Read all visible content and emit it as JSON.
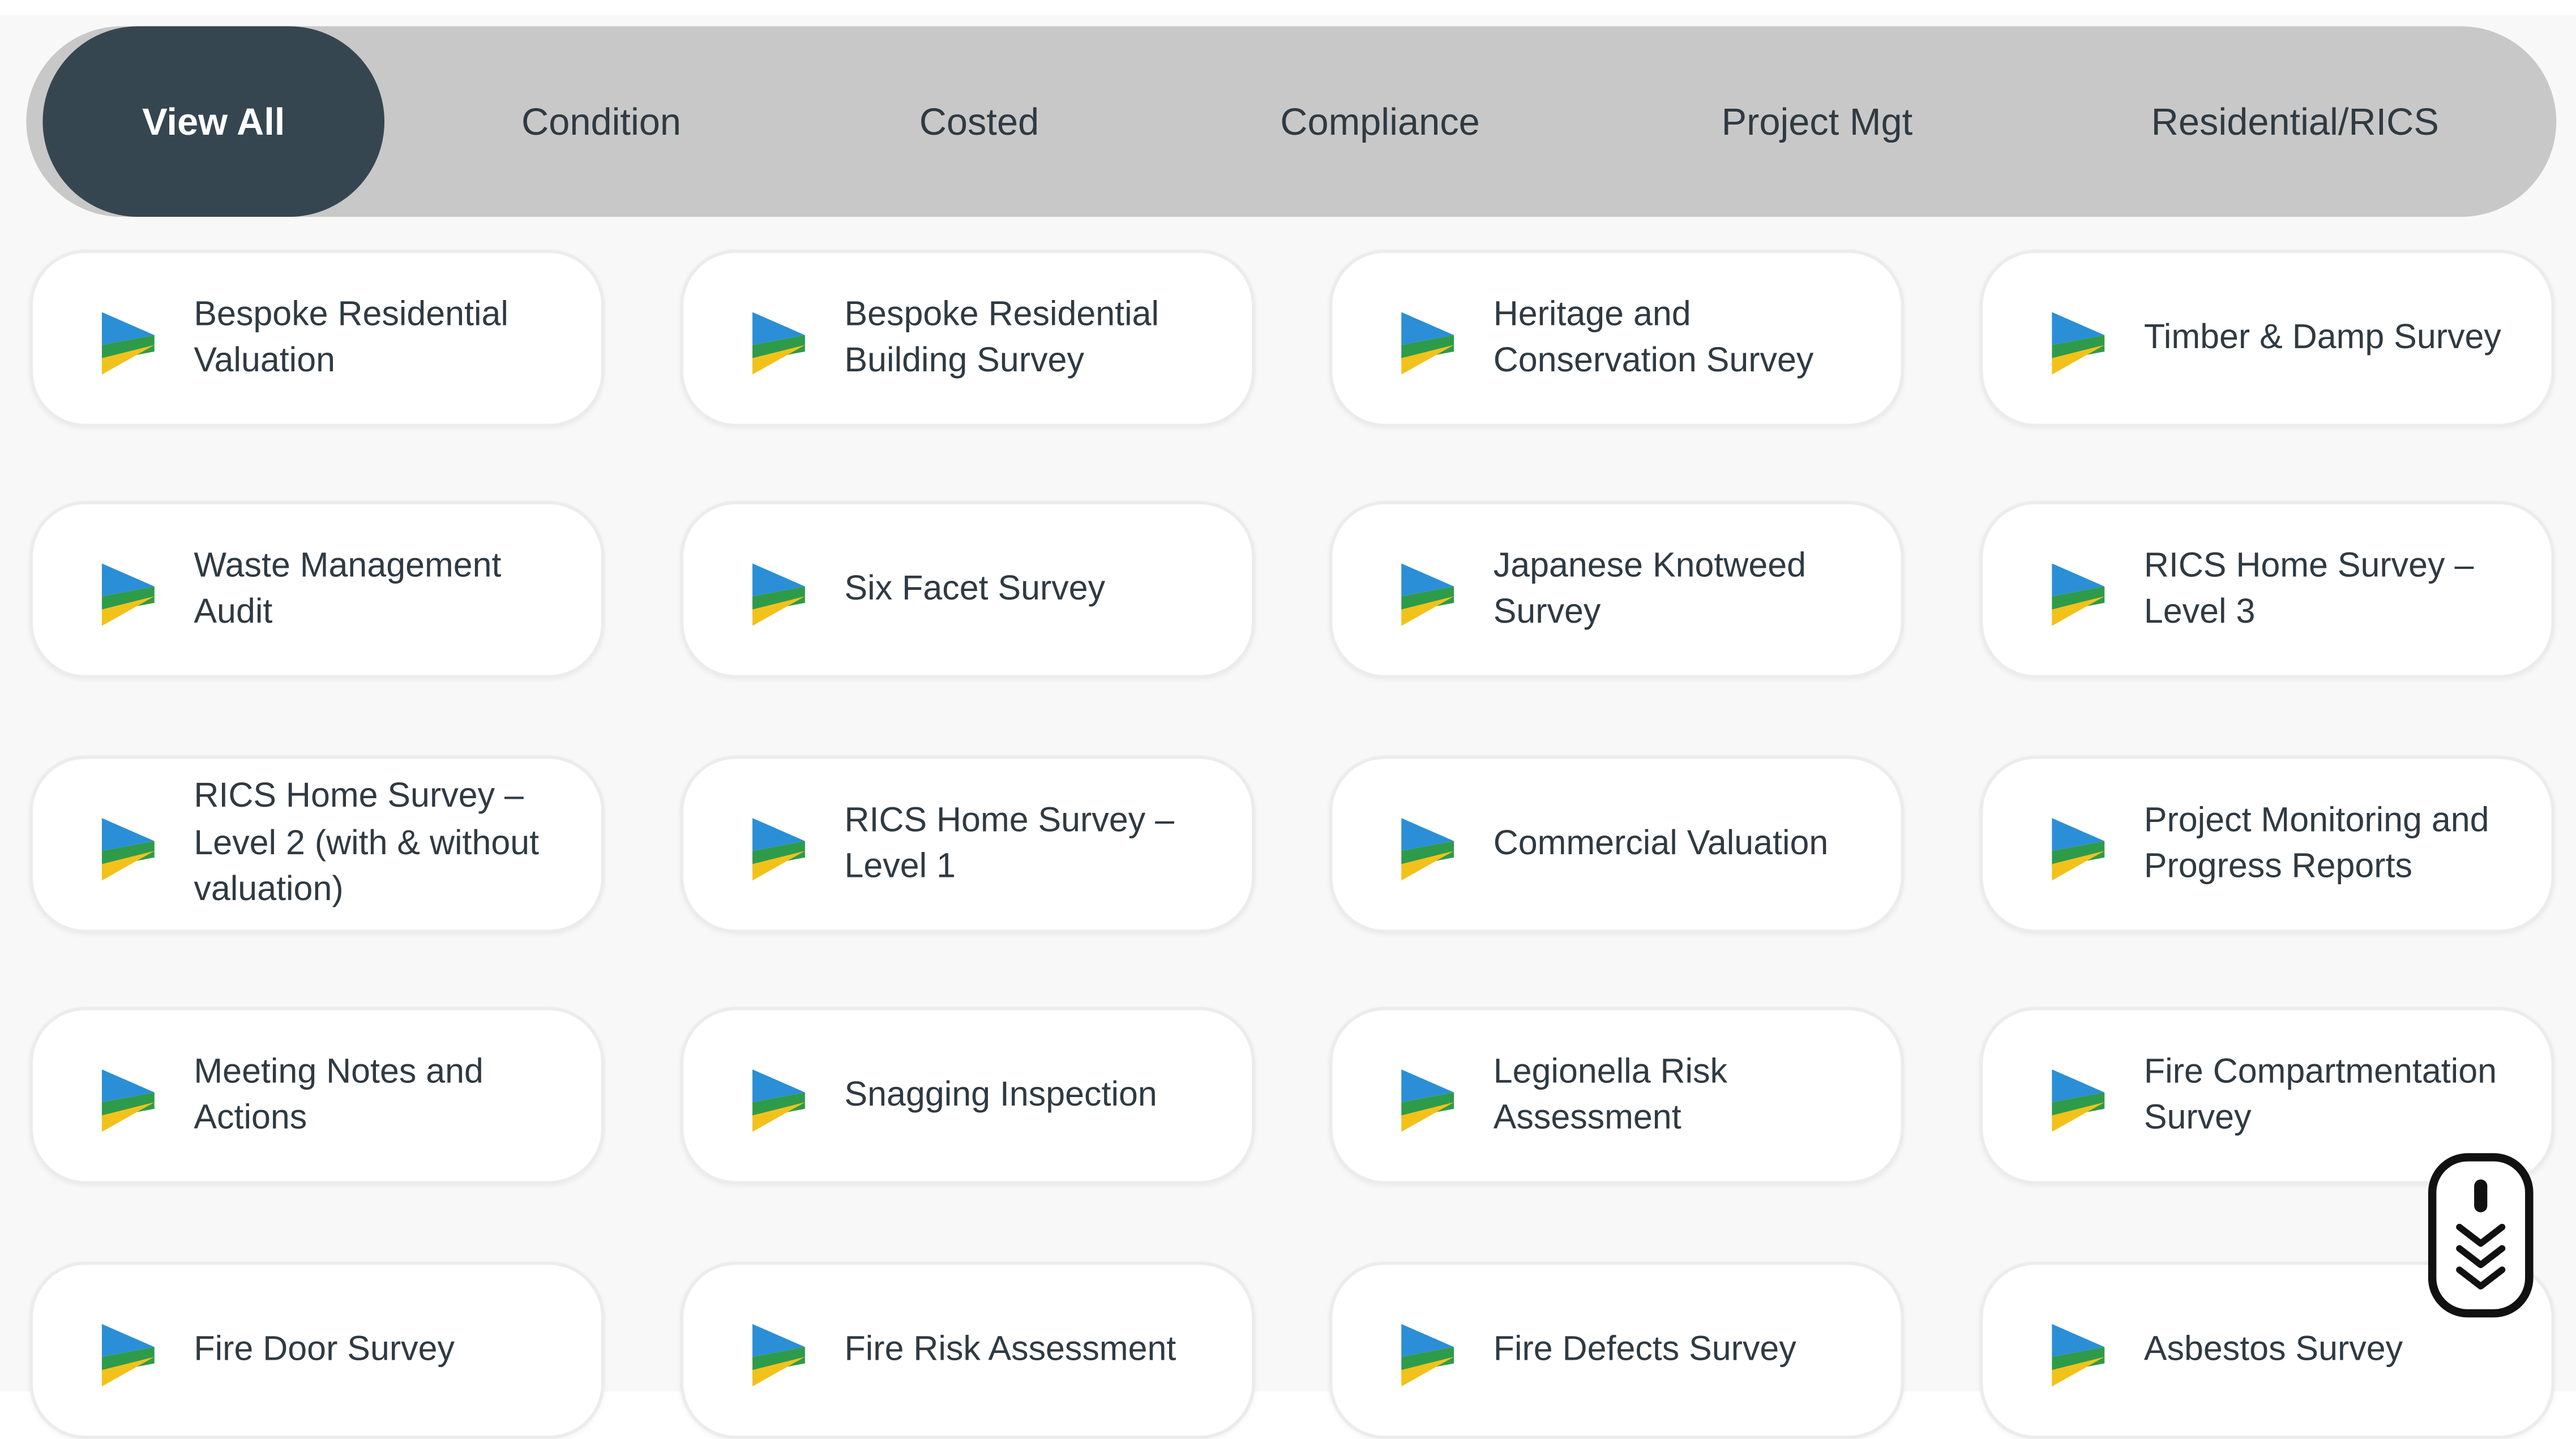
{
  "tabs": [
    {
      "label": "View All",
      "active": true
    },
    {
      "label": "Condition",
      "active": false
    },
    {
      "label": "Costed",
      "active": false
    },
    {
      "label": "Compliance",
      "active": false
    },
    {
      "label": "Project Mgt",
      "active": false
    },
    {
      "label": "Residential/RICS",
      "active": false
    }
  ],
  "cards": [
    {
      "label": "Bespoke Residential Valuation"
    },
    {
      "label": "Bespoke Residential Building Survey"
    },
    {
      "label": "Heritage and Conservation Survey"
    },
    {
      "label": "Timber & Damp Survey"
    },
    {
      "label": "Waste Management Audit"
    },
    {
      "label": "Six Facet Survey"
    },
    {
      "label": "Japanese Knotweed Survey"
    },
    {
      "label": "RICS Home Survey – Level 3"
    },
    {
      "label": "RICS Home Survey – Level 2 (with & without valuation)"
    },
    {
      "label": "RICS Home Survey – Level 1"
    },
    {
      "label": "Commercial Valuation"
    },
    {
      "label": "Project Monitoring and Progress Reports"
    },
    {
      "label": "Meeting Notes and Actions"
    },
    {
      "label": "Snagging Inspection"
    },
    {
      "label": "Legionella Risk Assessment"
    },
    {
      "label": "Fire Compartmentation Survey"
    },
    {
      "label": "Fire Door Survey"
    },
    {
      "label": "Fire Risk Assessment"
    },
    {
      "label": "Fire Defects Survey"
    },
    {
      "label": "Asbestos Survey"
    }
  ],
  "icons": {
    "card_icon": "survey-chevron-icon",
    "scroll_icon": "scroll-down-icon"
  },
  "colors": {
    "tabbar_bg": "#c8c8c8",
    "tab_active_bg": "#364650",
    "text": "#2f3a42",
    "icon_blue": "#2a8fd6",
    "icon_green": "#2e9b4a",
    "icon_yellow": "#f2c21b"
  }
}
